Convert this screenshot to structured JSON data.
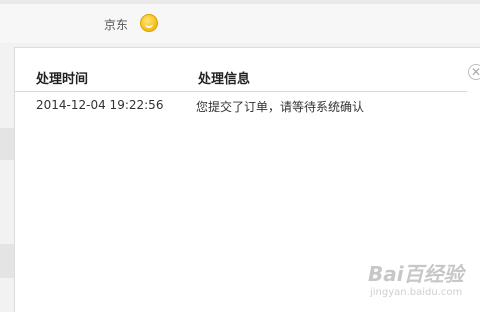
{
  "header": {
    "seller_name": "京东",
    "chat_icon": "smiley-chat-icon"
  },
  "popup": {
    "close_icon": "close-circle-icon",
    "columns": [
      "处理时间",
      "处理信息"
    ],
    "rows": [
      {
        "time": "2014-12-04 19:22:56",
        "info": "您提交了订单，请等待系统确认"
      }
    ]
  },
  "watermark": {
    "logo_text": "Bai百经验",
    "url": "jingyan.baidu.com"
  }
}
